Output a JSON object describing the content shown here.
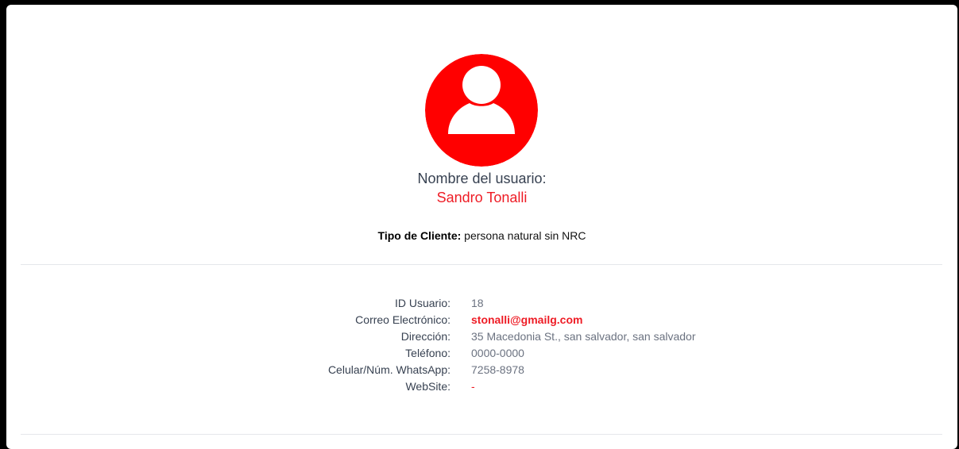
{
  "profile": {
    "name_label": "Nombre del usuario:",
    "name_value": "Sandro Tonalli",
    "avatar_icon": "user-icon",
    "avatar_color": "#ff0000"
  },
  "client_type": {
    "label": "Tipo de Cliente:",
    "value": "persona natural sin NRC"
  },
  "details": [
    {
      "label": "ID Usuario:",
      "value": "18"
    },
    {
      "label": "Correo Electrónico:",
      "value": "stonalli@gmailg.com"
    },
    {
      "label": "Dirección:",
      "value": "35 Macedonia St., san salvador, san salvador"
    },
    {
      "label": "Teléfono:",
      "value": "0000-0000"
    },
    {
      "label": "Celular/Núm. WhatsApp:",
      "value": "7258-8978"
    },
    {
      "label": "WebSite:",
      "value": "-"
    }
  ],
  "colors": {
    "accent": "#ee1c25",
    "muted": "#6b7280",
    "text": "#374151"
  }
}
